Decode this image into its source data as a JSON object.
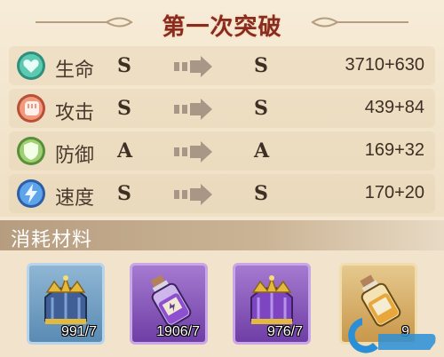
{
  "title": "第一次突破",
  "stats": [
    {
      "icon": "heart-icon",
      "label": "生命",
      "grade_before": "S",
      "grade_after": "S",
      "value": "3710+630",
      "color": "#46b79c"
    },
    {
      "icon": "fist-icon",
      "label": "攻击",
      "grade_before": "S",
      "grade_after": "S",
      "value": "439+84",
      "color": "#d9735a"
    },
    {
      "icon": "shield-icon",
      "label": "防御",
      "grade_before": "A",
      "grade_after": "A",
      "value": "169+32",
      "color": "#7db05a"
    },
    {
      "icon": "lightning-icon",
      "label": "速度",
      "grade_before": "S",
      "grade_after": "S",
      "value": "170+20",
      "color": "#4c8fd6"
    }
  ],
  "materials_title": "消耗材料",
  "materials": [
    {
      "icon": "blue-crown-icon",
      "count": "991/7",
      "rarity": "blue"
    },
    {
      "icon": "purple-potion-icon",
      "count": "1906/7",
      "rarity": "purple"
    },
    {
      "icon": "purple-crown-icon",
      "count": "976/7",
      "rarity": "purple"
    },
    {
      "icon": "gold-potion-icon",
      "count": "9",
      "rarity": "gold"
    }
  ]
}
